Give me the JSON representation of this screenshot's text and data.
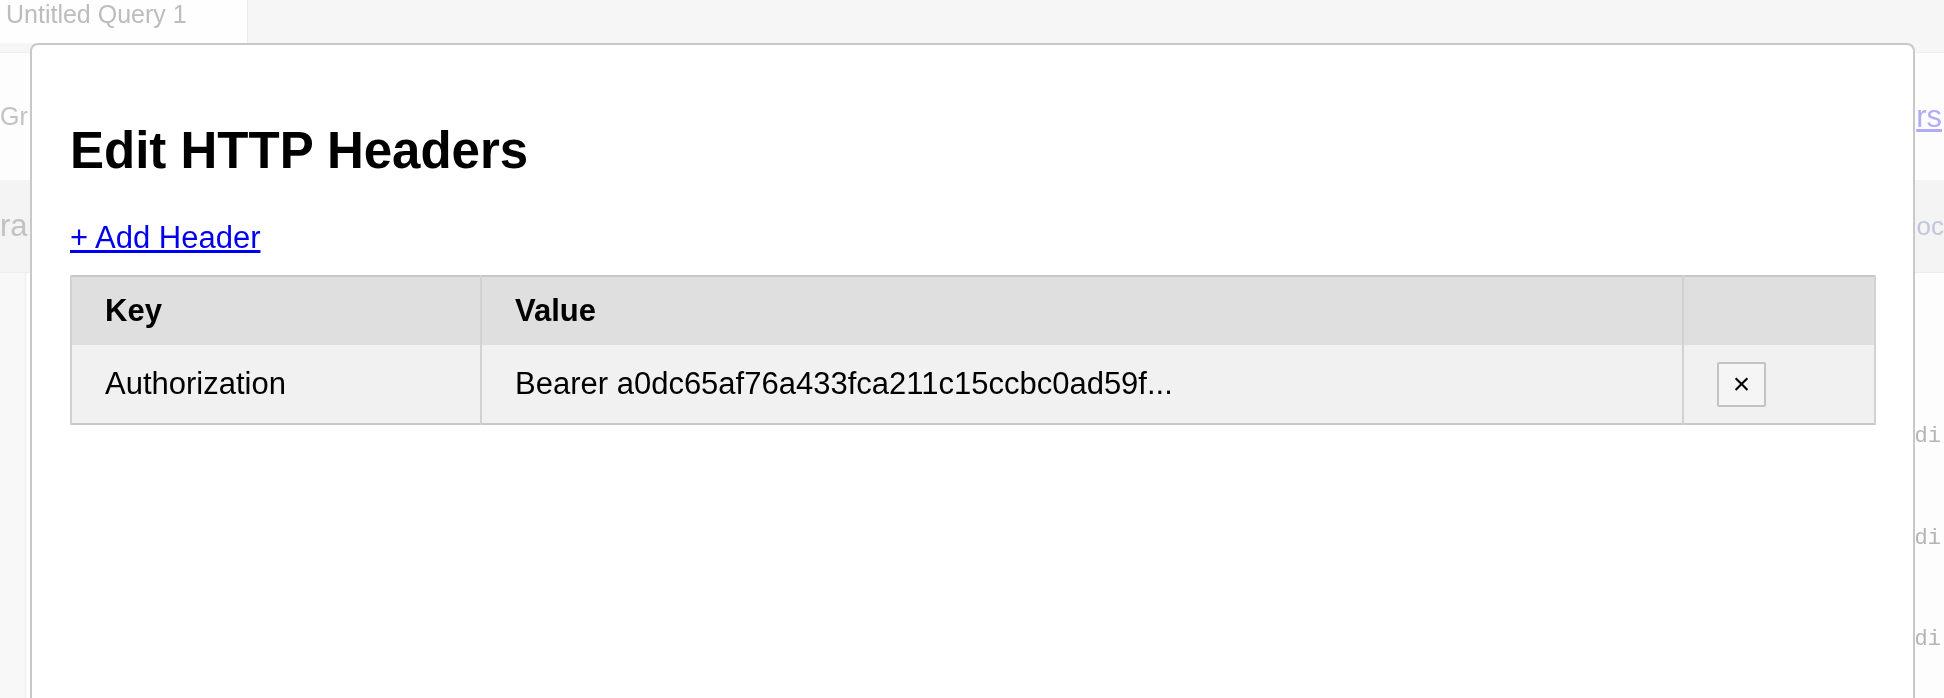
{
  "background_page": {
    "tabs": [
      {
        "label": "Untitled Query 1",
        "selected": true
      }
    ],
    "header": {
      "left_text": "Gr",
      "right_link": "rs"
    },
    "toolbar": {
      "left_text": "ra",
      "right_text": "oc"
    },
    "editor_lines": [
      "di",
      "di",
      "di"
    ]
  },
  "dialog": {
    "title": "Edit HTTP Headers",
    "add_link": "+ Add Header",
    "table": {
      "columns": [
        "Key",
        "Value"
      ],
      "rows": [
        {
          "key": "Authorization",
          "value": "Bearer a0dc65af76a433fca211c15ccbc0ad59f...",
          "delete_button": "×"
        }
      ]
    }
  }
}
